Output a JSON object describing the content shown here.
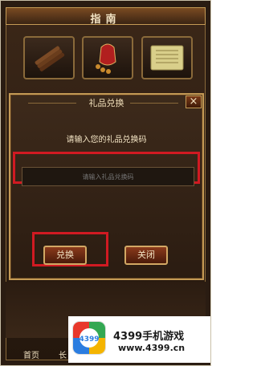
{
  "header": {
    "title": "指南"
  },
  "icons": [
    {
      "name": "bamboo-scroll-icon"
    },
    {
      "name": "gift-bag-icon"
    },
    {
      "name": "paper-scroll-icon"
    }
  ],
  "dialog": {
    "title": "礼品兑换",
    "prompt": "请输入您的礼品兑换码",
    "input_placeholder": "请输入礼品兑换码",
    "redeem_label": "兑换",
    "close_label": "关闭"
  },
  "footer": {
    "home_label": "首页",
    "partial_label": "长"
  },
  "watermark": {
    "logo_text": "4399",
    "title": "4399手机游戏",
    "url": "www.4399.cn"
  },
  "colors": {
    "highlight": "#d11a22",
    "gold_border": "#c49a55"
  }
}
